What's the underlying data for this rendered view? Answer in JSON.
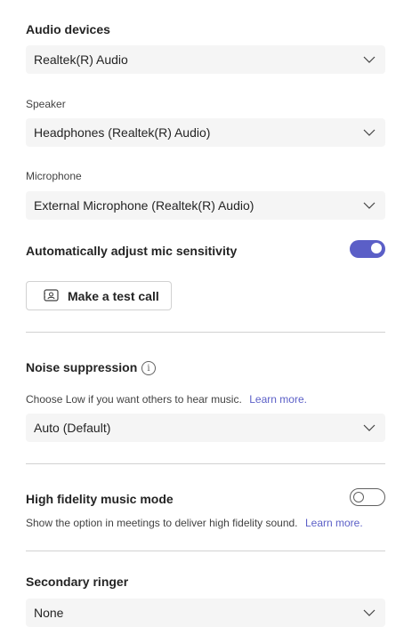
{
  "audio_devices": {
    "heading": "Audio devices",
    "selected": "Realtek(R) Audio"
  },
  "speaker": {
    "label": "Speaker",
    "selected": "Headphones (Realtek(R) Audio)"
  },
  "microphone": {
    "label": "Microphone",
    "selected": "External Microphone (Realtek(R) Audio)"
  },
  "auto_adjust": {
    "label": "Automatically adjust mic sensitivity",
    "enabled": true
  },
  "test_call": {
    "label": "Make a test call",
    "icon": "test-call-icon"
  },
  "noise_suppression": {
    "heading": "Noise suppression",
    "description": "Choose Low if you want others to hear music.",
    "link": "Learn more.",
    "selected": "Auto (Default)"
  },
  "high_fidelity": {
    "heading": "High fidelity music mode",
    "description": "Show the option in meetings to deliver high fidelity sound.",
    "link": "Learn more.",
    "enabled": false
  },
  "secondary_ringer": {
    "heading": "Secondary ringer",
    "selected": "None"
  },
  "colors": {
    "accent": "#5b5fc7",
    "dropdown_bg": "#f5f5f5",
    "divider": "#d1d1d1"
  }
}
